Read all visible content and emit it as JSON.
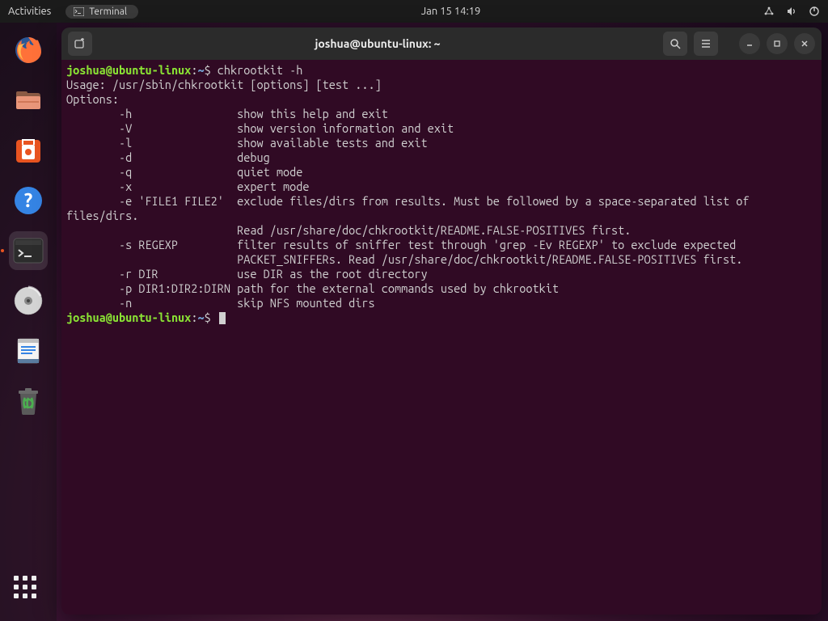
{
  "topbar": {
    "activities": "Activities",
    "app_label": "Terminal",
    "clock": "Jan 15  14:19"
  },
  "dock": {
    "items": [
      {
        "name": "firefox"
      },
      {
        "name": "files"
      },
      {
        "name": "software"
      },
      {
        "name": "help"
      },
      {
        "name": "terminal",
        "active": true
      },
      {
        "name": "disc"
      },
      {
        "name": "text-editor"
      },
      {
        "name": "trash"
      }
    ]
  },
  "window": {
    "title": "joshua@ubuntu-linux: ~"
  },
  "prompt": {
    "user": "joshua",
    "at": "@",
    "host": "ubuntu-linux",
    "colon": ":",
    "path": "~",
    "dollar": "$"
  },
  "terminal": {
    "cmd1": " chkrootkit -h",
    "lines": [
      "Usage: /usr/sbin/chkrootkit [options] [test ...]",
      "Options:",
      "        -h                show this help and exit",
      "        -V                show version information and exit",
      "        -l                show available tests and exit",
      "        -d                debug",
      "        -q                quiet mode",
      "        -x                expert mode",
      "        -e 'FILE1 FILE2'  exclude files/dirs from results. Must be followed by a space-separated list of",
      "files/dirs.",
      "                          Read /usr/share/doc/chkrootkit/README.FALSE-POSITIVES first.",
      "        -s REGEXP         filter results of sniffer test through 'grep -Ev REGEXP' to exclude expected",
      "                          PACKET_SNIFFERs. Read /usr/share/doc/chkrootkit/README.FALSE-POSITIVES first.",
      "        -r DIR            use DIR as the root directory",
      "        -p DIR1:DIR2:DIRN path for the external commands used by chkrootkit",
      "        -n                skip NFS mounted dirs"
    ]
  }
}
